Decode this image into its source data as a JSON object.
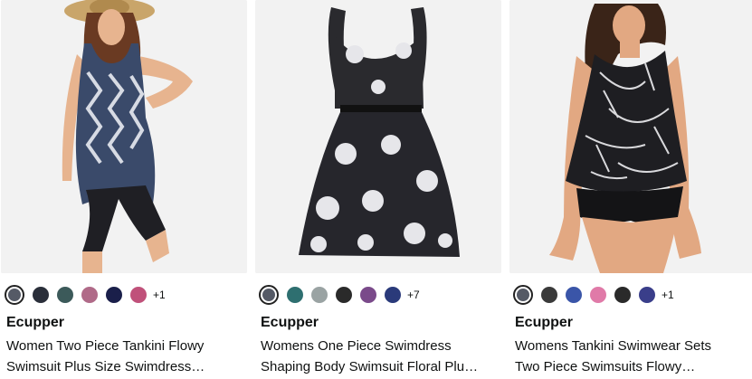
{
  "products": [
    {
      "brand": "Ecupper",
      "title_line1": "Women Two Piece Tankini Flowy",
      "title_line2": "Swimsuit Plus Size Swimdress…",
      "more_colors": "+1",
      "swatch_colors": [
        "#555a66",
        "#2a2f3a",
        "#3c5a5a",
        "#b06a88",
        "#1a1f4a",
        "#c0517a"
      ]
    },
    {
      "brand": "Ecupper",
      "title_line1": "Womens One Piece Swimdress",
      "title_line2": "Shaping Body Swimsuit Floral Plu…",
      "more_colors": "+7",
      "swatch_colors": [
        "#555a66",
        "#2e6f70",
        "#9aa3a3",
        "#2a2a2a",
        "#7a4a8a",
        "#2a3a7a"
      ]
    },
    {
      "brand": "Ecupper",
      "title_line1": "Womens Tankini Swimwear Sets",
      "title_line2": "Two Piece Swimsuits Flowy…",
      "more_colors": "+1",
      "swatch_colors": [
        "#555a66",
        "#3a3a3a",
        "#3a55a8",
        "#e07aa8",
        "#2a2a2a",
        "#3a3e8a"
      ]
    }
  ]
}
